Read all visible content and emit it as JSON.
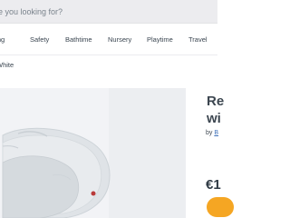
{
  "search": {
    "placeholder": "e you looking for?"
  },
  "nav": {
    "items": [
      "ding",
      "Safety",
      "Bathtime",
      "Nursery",
      "Playtime",
      "Travel"
    ]
  },
  "product": {
    "variant": "White",
    "title_line1": "Re",
    "title_line2": "wi",
    "brand_prefix": "by ",
    "brand_link": "B",
    "price": "€1"
  },
  "colors": {
    "accent": "#f5a623",
    "link": "#3d6fb8"
  }
}
